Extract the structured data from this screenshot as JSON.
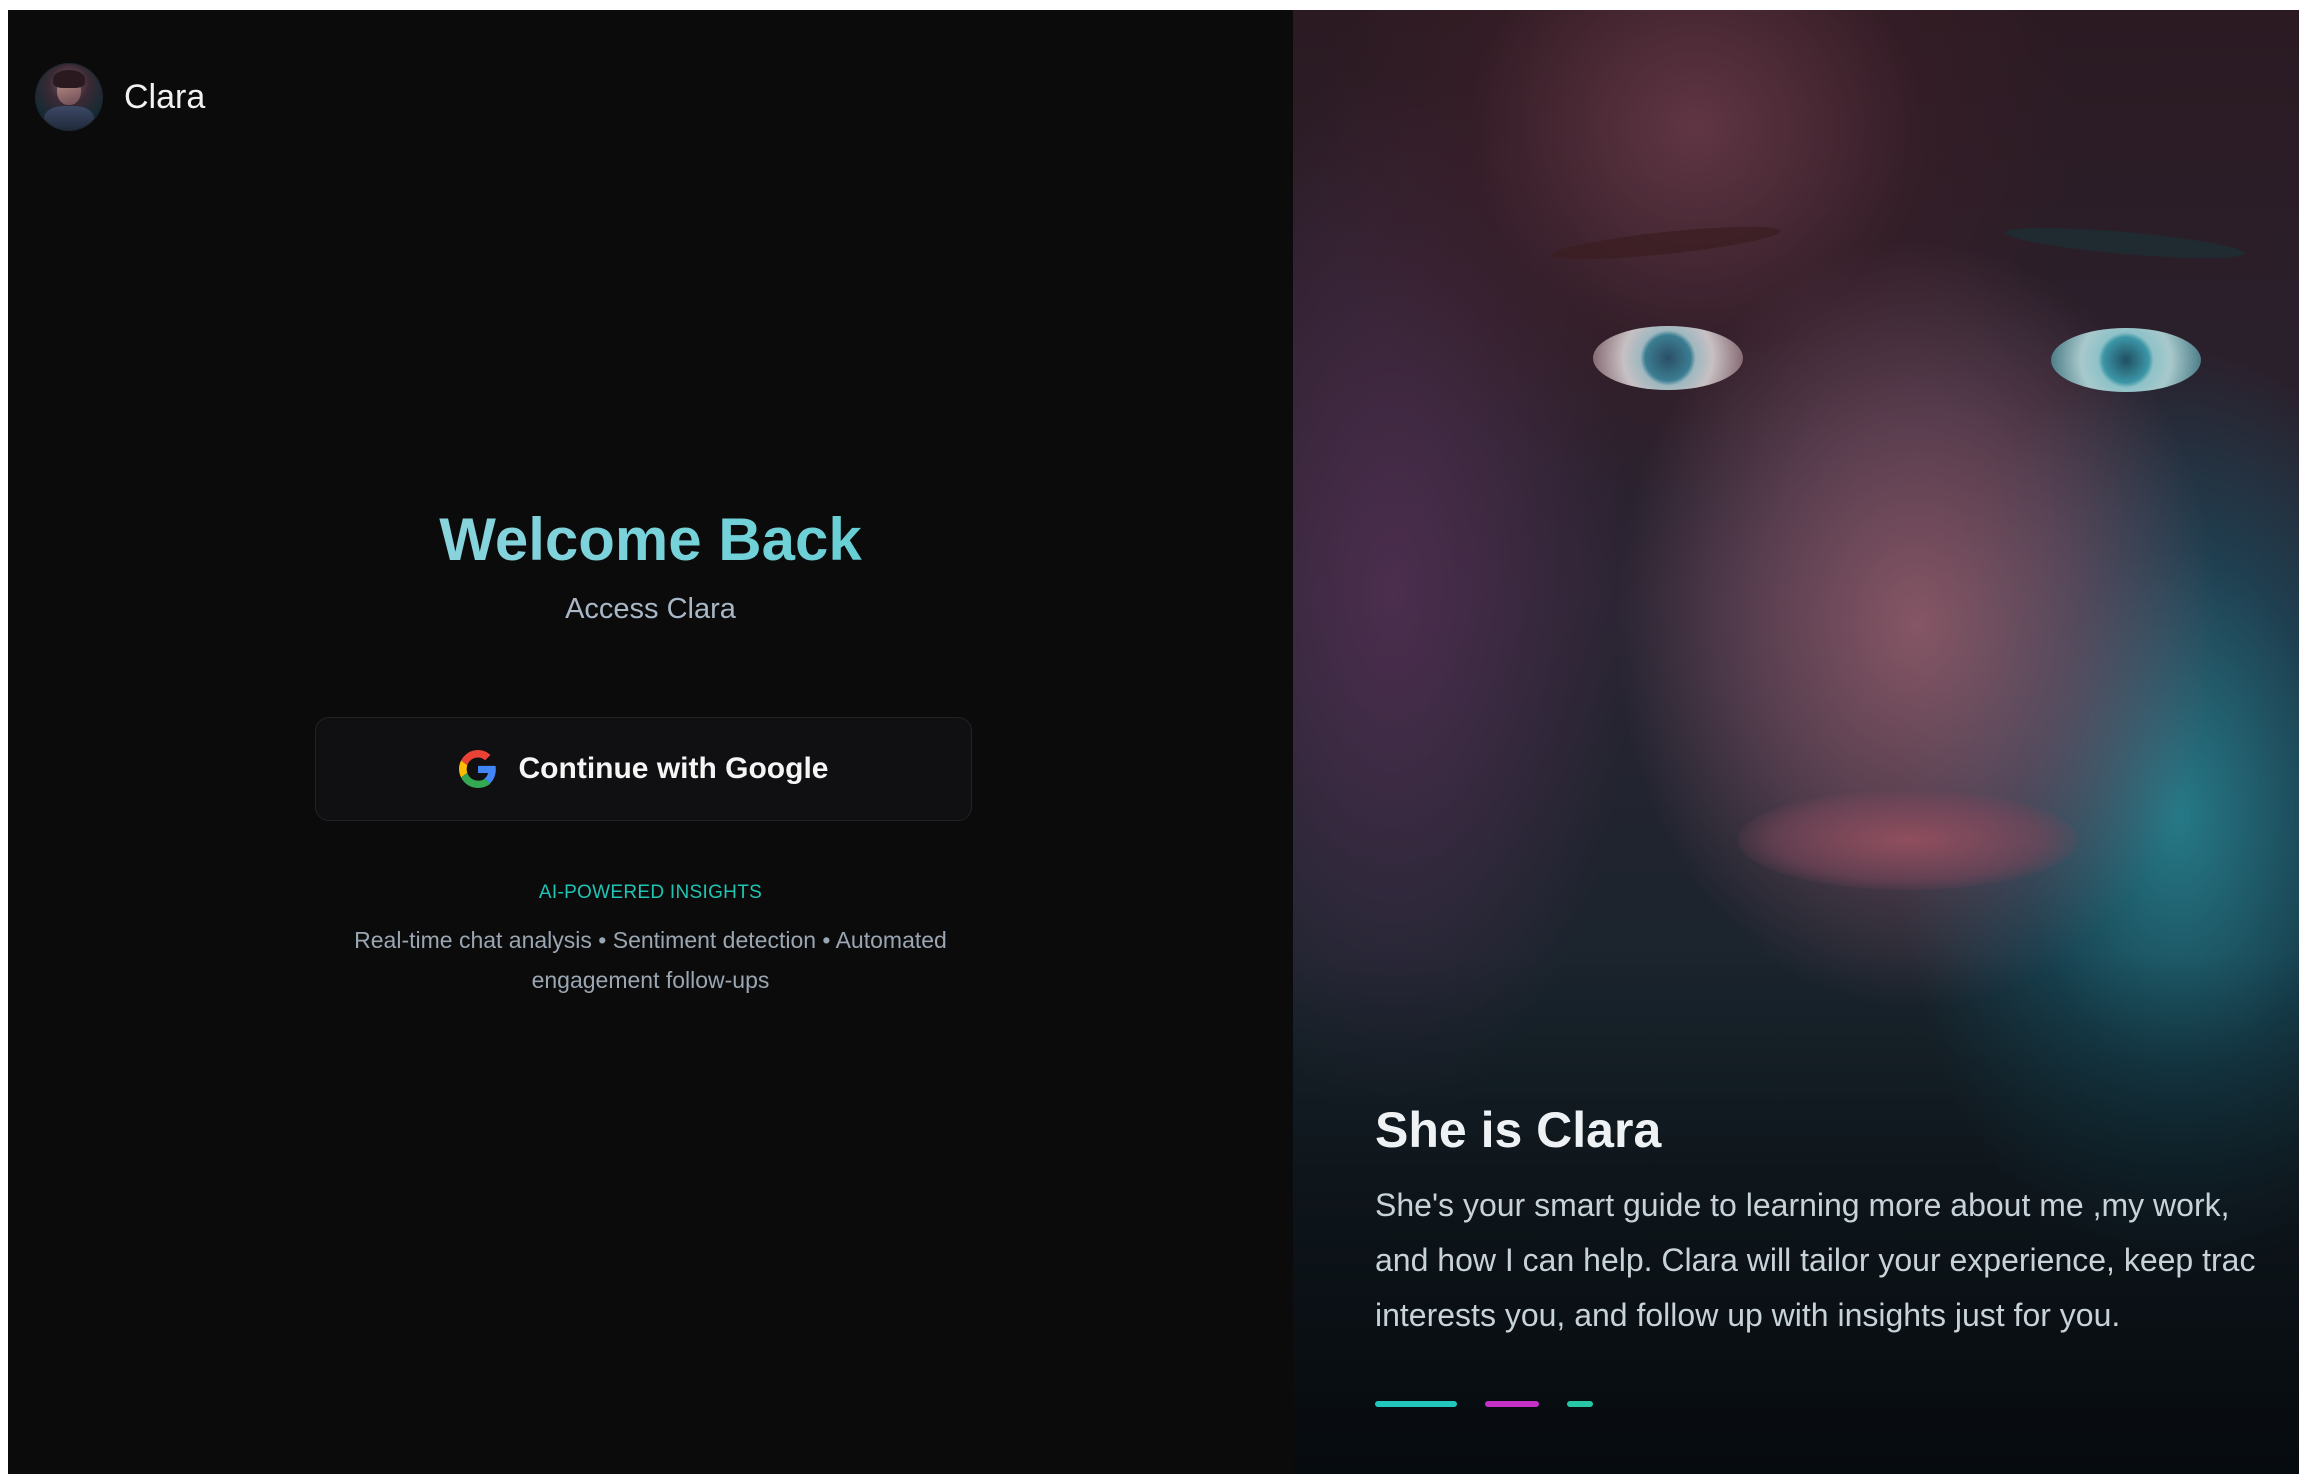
{
  "brand": {
    "name": "Clara"
  },
  "login": {
    "title": "Welcome Back",
    "subtitle": "Access Clara",
    "google_button_label": "Continue with Google"
  },
  "insights": {
    "badge": "AI-POWERED INSIGHTS",
    "features": "Real-time chat analysis • Sentiment detection • Automated engagement follow-ups"
  },
  "hero": {
    "heading": "She is Clara",
    "description_lines": [
      "She's your smart guide to learning more about me ,my work,",
      "and how I can help. Clara will tailor your experience, keep trac",
      "interests you, and follow up with insights just for you."
    ],
    "carousel": {
      "slide_count": 3,
      "active_index": 0,
      "colors": [
        "#21c7bd",
        "#c530c7",
        "#27c7a5"
      ]
    }
  },
  "colors": {
    "background": "#0b0b0c",
    "accent_teal": "#1fc4b2",
    "button_bg": "#101012"
  },
  "icons": {
    "google": "google-g-icon",
    "avatar": "clara-avatar"
  }
}
